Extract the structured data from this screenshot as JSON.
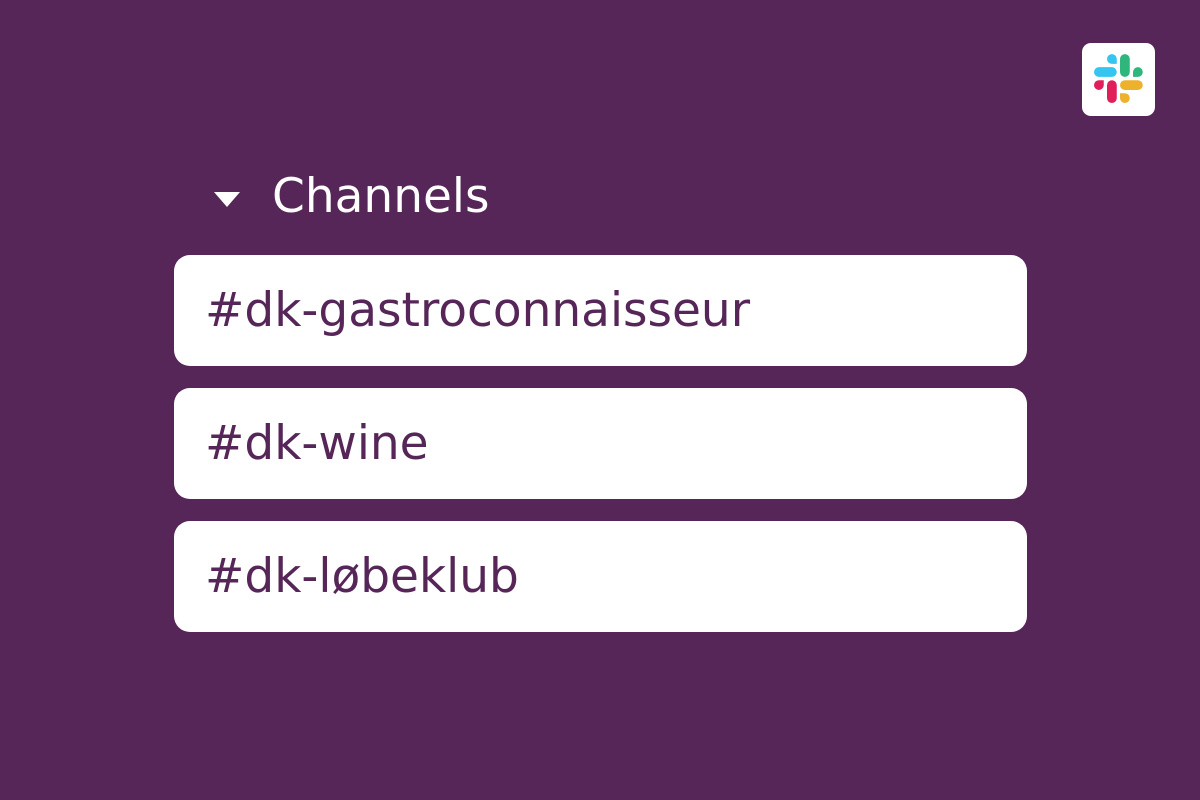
{
  "logo": {
    "icon": "slack-logo-icon",
    "colors": {
      "blue": "#36C5F0",
      "green": "#2EB67D",
      "yellow": "#ECB22E",
      "red": "#E01E5A"
    }
  },
  "section": {
    "icon": "caret-down-icon",
    "title": "Channels"
  },
  "channels": [
    {
      "name": "#dk-gastroconnaisseur"
    },
    {
      "name": "#dk-wine"
    },
    {
      "name": "#dk-løbeklub"
    }
  ],
  "colors": {
    "background": "#552657",
    "channel_text": "#552657",
    "item_background": "#FFFFFF"
  }
}
